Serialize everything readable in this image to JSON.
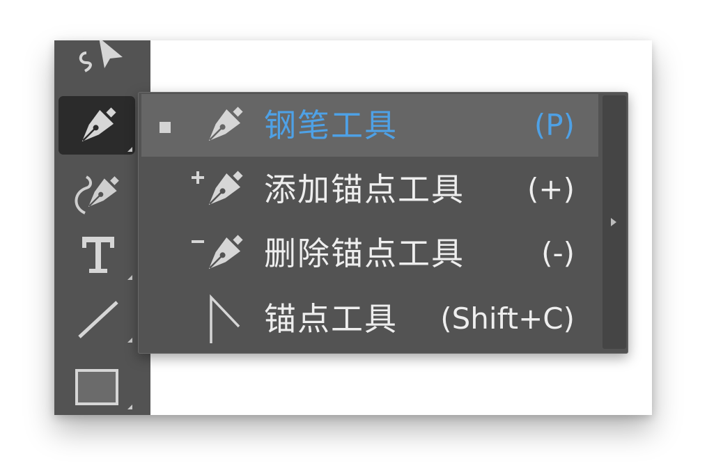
{
  "toolbar": {
    "tools": [
      {
        "name": "curvature-select-tool"
      },
      {
        "name": "pen-tool",
        "active": true
      },
      {
        "name": "curvature-tool"
      },
      {
        "name": "type-tool"
      },
      {
        "name": "line-segment-tool"
      },
      {
        "name": "rectangle-tool"
      }
    ]
  },
  "flyout": {
    "items": [
      {
        "label": "钢笔工具",
        "shortcut": "(P)",
        "icon": "pen-icon",
        "selected": true
      },
      {
        "label": "添加锚点工具",
        "shortcut": "(+)",
        "icon": "add-anchor-point-icon"
      },
      {
        "label": "删除锚点工具",
        "shortcut": "(-)",
        "icon": "delete-anchor-point-icon"
      },
      {
        "label": "锚点工具",
        "shortcut": "(Shift+C)",
        "icon": "anchor-point-icon"
      }
    ]
  },
  "colors": {
    "toolbar_bg": "#535353",
    "selected_bg": "#666666",
    "accent": "#4ea1e6",
    "text": "#eeeeee"
  }
}
